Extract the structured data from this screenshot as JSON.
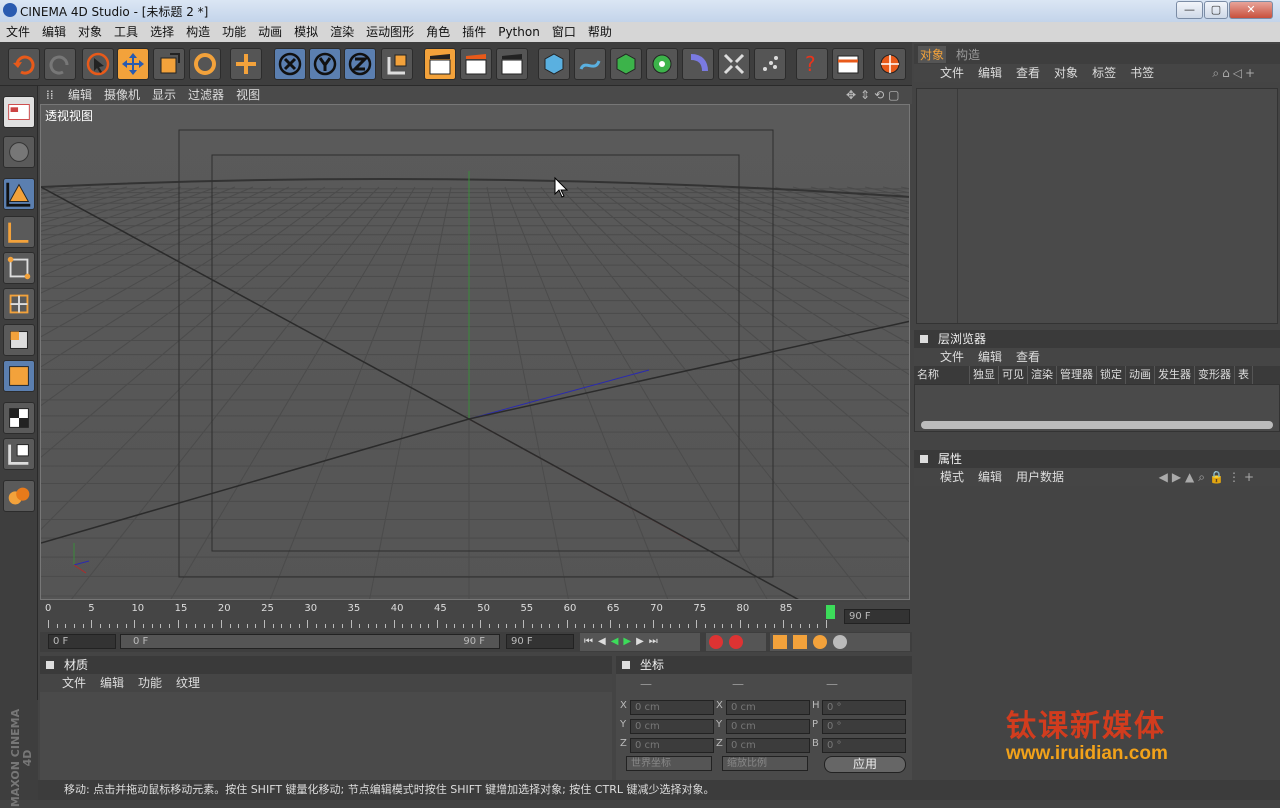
{
  "window": {
    "title": "CINEMA 4D Studio - [未标题 2 *]",
    "minimize": "—",
    "maximize": "▢",
    "close": "✕"
  },
  "menubar": [
    "文件",
    "编辑",
    "对象",
    "工具",
    "选择",
    "构造",
    "功能",
    "动画",
    "模拟",
    "渲染",
    "运动图形",
    "角色",
    "插件",
    "Python",
    "窗口",
    "帮助"
  ],
  "viewport": {
    "menu": [
      "编辑",
      "摄像机",
      "显示",
      "过滤器",
      "视图"
    ],
    "label": "透视视图"
  },
  "timeline": {
    "ticks": [
      "0",
      "5",
      "10",
      "15",
      "20",
      "25",
      "30",
      "35",
      "40",
      "45",
      "50",
      "55",
      "60",
      "65",
      "70",
      "75",
      "80",
      "85"
    ],
    "end_frame": "90 F",
    "current": "0 F",
    "range_start": "0 F",
    "range_end": "90 F",
    "max_frame": "90 F"
  },
  "materials": {
    "title": "材质",
    "menu": [
      "文件",
      "编辑",
      "功能",
      "纹理"
    ]
  },
  "coordinates": {
    "title": "坐标",
    "col_heads": [
      "—",
      "—",
      "—"
    ],
    "rows": [
      {
        "a": "X",
        "av": "0 cm",
        "b": "X",
        "bv": "0 cm",
        "c": "H",
        "cv": "0 °"
      },
      {
        "a": "Y",
        "av": "0 cm",
        "b": "Y",
        "bv": "0 cm",
        "c": "P",
        "cv": "0 °"
      },
      {
        "a": "Z",
        "av": "0 cm",
        "b": "Z",
        "bv": "0 cm",
        "c": "B",
        "cv": "0 °"
      }
    ],
    "world_coords": "世界坐标",
    "scale_ratio": "缩放比例",
    "apply": "应用"
  },
  "objects_panel": {
    "tabs": [
      "对象",
      "构造"
    ],
    "menu": [
      "文件",
      "编辑",
      "查看",
      "对象",
      "标签",
      "书签"
    ]
  },
  "layer_browser": {
    "title": "层浏览器",
    "menu": [
      "文件",
      "编辑",
      "查看"
    ],
    "columns": [
      "名称",
      "独显",
      "可见",
      "渲染",
      "管理器",
      "锁定",
      "动画",
      "发生器",
      "变形器",
      "表"
    ]
  },
  "attributes": {
    "title": "属性",
    "menu": [
      "模式",
      "编辑",
      "用户数据"
    ]
  },
  "status": "移动: 点击并拖动鼠标移动元素。按住 SHIFT 键量化移动; 节点编辑模式时按住 SHIFT 键增加选择对象; 按住 CTRL 键减少选择对象。",
  "watermark": {
    "line1": "钛课新媒体",
    "line2": "www.iruidian.com"
  },
  "logo": "MAXON CINEMA 4D"
}
